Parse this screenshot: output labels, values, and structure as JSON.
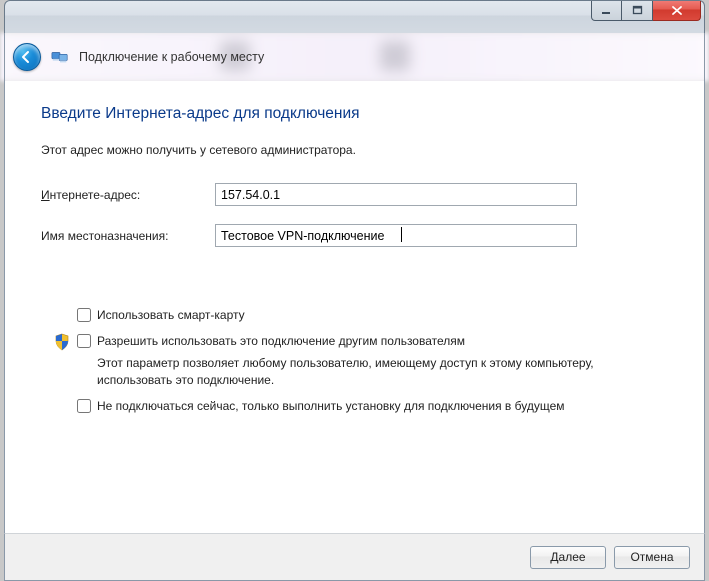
{
  "window": {
    "wizard_title": "Подключение к рабочему месту"
  },
  "page": {
    "heading": "Введите Интернета-адрес для подключения",
    "subtext": "Этот адрес можно получить у сетевого администратора."
  },
  "fields": {
    "address": {
      "label_pre": "И",
      "label_rest": "нтернете-адрес:",
      "value": "157.54.0.1"
    },
    "destination": {
      "label": "Имя местоназначения:",
      "value": "Тестовое VPN-подключение"
    }
  },
  "checks": {
    "smartcard": {
      "label_pre": "Использовать ",
      "label_ul": "с",
      "label_rest": "март-карту"
    },
    "share": {
      "label_ul": "Р",
      "label_rest": "азрешить использовать это подключение другим пользователям",
      "desc": "Этот параметр позволяет любому пользователю, имеющему доступ к этому компьютеру, использовать это подключение."
    },
    "later": {
      "label_pre": "Н",
      "label_rest": "е подключаться сейчас, только выполнить установку для подключения в будущем"
    }
  },
  "buttons": {
    "next": "Далее",
    "cancel": "Отмена"
  }
}
